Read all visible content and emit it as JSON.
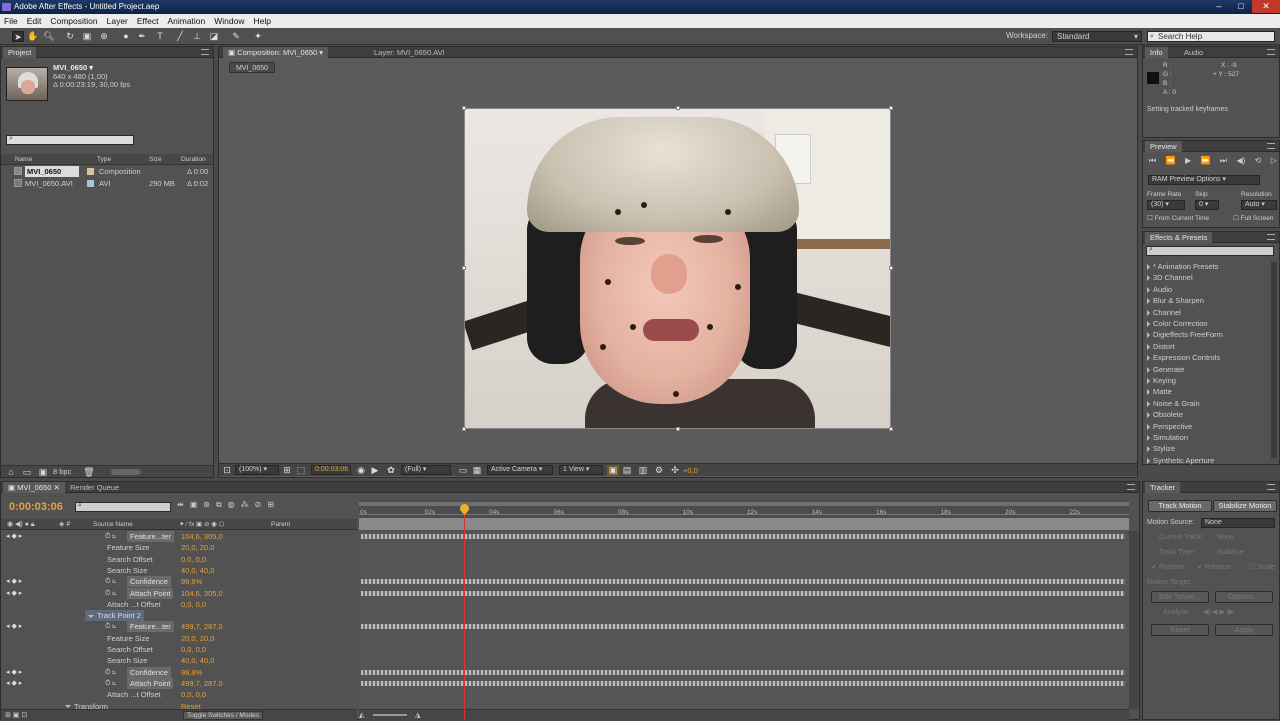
{
  "window": {
    "title": "Adobe After Effects - Untitled Project.aep",
    "min": "–",
    "max": "□",
    "close": "✕"
  },
  "menu": [
    "File",
    "Edit",
    "Composition",
    "Layer",
    "Effect",
    "Animation",
    "Window",
    "Help"
  ],
  "toolbar": {
    "workspace_label": "Workspace:",
    "workspace_value": "Standard",
    "search_placeholder": "Search Help"
  },
  "project": {
    "tab": "Project",
    "item_name": "MVI_0650 ▾",
    "item_size": "640 x 480 (1,00)",
    "item_duration": "Δ 0:00:23:19, 30,00 fps",
    "columns": {
      "name": "Name",
      "type": "Type",
      "size": "Size",
      "duration": "Duration"
    },
    "rows": [
      {
        "name": "MVI_0650",
        "type": "Composition",
        "size": "",
        "duration": "Δ 0:00"
      },
      {
        "name": "MVI_0650.AVI",
        "type": "AVI",
        "size": "290 MB",
        "duration": "Δ 0:02"
      }
    ],
    "bpc": "8 bpc"
  },
  "composition": {
    "tab": "Composition: MVI_0650",
    "layer_tab": "Layer: MVI_0650.AVI",
    "breadcrumb": "MVI_0650",
    "zoom": "(100%)",
    "timecode": "0:00:03:06",
    "resolution": "(Full)",
    "camera": "Active Camera",
    "view": "1 View",
    "exposure": "+0,0"
  },
  "info": {
    "tabs": [
      "Info",
      "Audio"
    ],
    "r": "R :",
    "g": "G :",
    "b": "B :",
    "a": "A : 0",
    "x": "X : -9",
    "y": "+ Y : 527",
    "status": "Setting tracked keyframes"
  },
  "preview": {
    "tab": "Preview",
    "ram": "RAM Preview Options",
    "frame_rate_label": "Frame Rate",
    "skip_label": "Skip",
    "resolution_label": "Resolution",
    "frame_rate": "(30)",
    "skip": "0",
    "resolution": "Auto",
    "from_current": "From Current Time",
    "full_screen": "Full Screen"
  },
  "effects": {
    "tab": "Effects & Presets",
    "items": [
      "* Animation Presets",
      "3D Channel",
      "Audio",
      "Blur & Sharpen",
      "Channel",
      "Color Correction",
      "Digieffects FreeForm",
      "Distort",
      "Expression Controls",
      "Generate",
      "Keying",
      "Matte",
      "Noise & Grain",
      "Obsolete",
      "Perspective",
      "Simulation",
      "Stylize",
      "Synthetic Aperture"
    ]
  },
  "tracker": {
    "tab": "Tracker",
    "track_motion": "Track Motion",
    "stabilize_motion": "Stabilize Motion",
    "motion_source_label": "Motion Source:",
    "motion_source": "None",
    "current_track_label": "Current Track:",
    "current_track": "None",
    "track_type_label": "Track Type:",
    "track_type": "Stabilize",
    "position": "Position",
    "rotation": "Rotation",
    "scale": "Scale",
    "motion_target": "Motion Target:",
    "edit_target": "Edit Target...",
    "options": "Options...",
    "analyze": "Analyze:",
    "reset": "Reset",
    "apply": "Apply"
  },
  "timeline": {
    "tabs": [
      "MVI_0650",
      "Render Queue"
    ],
    "timecode": "0:00:03:06",
    "columns": {
      "source": "Source Name",
      "parent": "Parent"
    },
    "ruler": [
      "0s",
      "02s",
      "04s",
      "06s",
      "08s",
      "10s",
      "12s",
      "14s",
      "16s",
      "18s",
      "20s",
      "22s"
    ],
    "toggle": "Toggle Switches / Modes",
    "rows": [
      {
        "label": "Feature...ter",
        "value": "104,6, 305,0",
        "hl": true
      },
      {
        "label": "Feature Size",
        "value": "20,0, 20,0"
      },
      {
        "label": "Search Offset",
        "value": "0,0, 0,0"
      },
      {
        "label": "Search Size",
        "value": "40,0, 40,0"
      },
      {
        "label": "Confidence",
        "value": "99,8%",
        "hl": true
      },
      {
        "label": "Attach Point",
        "value": "104,6, 305,0",
        "hl": true
      },
      {
        "label": "Attach ...t Offset",
        "value": "0,0, 0,0"
      },
      {
        "label": "Track Point 2",
        "value": "",
        "group": true
      },
      {
        "label": "Feature...ter",
        "value": "499,7, 287,0",
        "hl": true
      },
      {
        "label": "Feature Size",
        "value": "20,0, 20,0"
      },
      {
        "label": "Search Offset",
        "value": "0,0, 0,0"
      },
      {
        "label": "Search Size",
        "value": "40,0, 40,0"
      },
      {
        "label": "Confidence",
        "value": "99,8%",
        "hl": true
      },
      {
        "label": "Attach Point",
        "value": "499,7, 287,0",
        "hl": true
      },
      {
        "label": "Attach ...t Offset",
        "value": "0,0, 0,0"
      },
      {
        "label": "Transform",
        "value": "Reset",
        "group": true
      }
    ]
  }
}
